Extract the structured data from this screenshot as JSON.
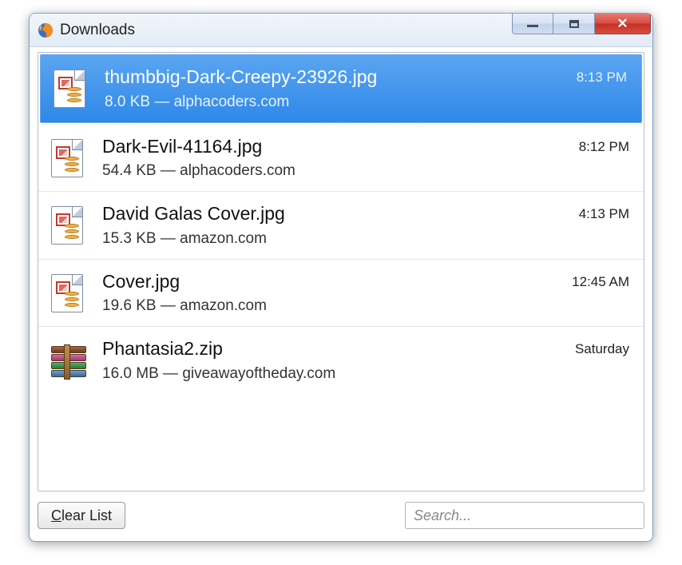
{
  "window": {
    "title": "Downloads"
  },
  "items": [
    {
      "filename": "thumbbig-Dark-Creepy-23926.jpg",
      "size": "8.0 KB",
      "source": "alphacoders.com",
      "time": "8:13 PM",
      "kind": "image",
      "selected": true
    },
    {
      "filename": "Dark-Evil-41164.jpg",
      "size": "54.4 KB",
      "source": "alphacoders.com",
      "time": "8:12 PM",
      "kind": "image",
      "selected": false
    },
    {
      "filename": "David Galas Cover.jpg",
      "size": "15.3 KB",
      "source": "amazon.com",
      "time": "4:13 PM",
      "kind": "image",
      "selected": false
    },
    {
      "filename": "Cover.jpg",
      "size": "19.6 KB",
      "source": "amazon.com",
      "time": "12:45 AM",
      "kind": "image",
      "selected": false
    },
    {
      "filename": "Phantasia2.zip",
      "size": "16.0 MB",
      "source": "giveawayoftheday.com",
      "time": "Saturday",
      "kind": "zip",
      "selected": false
    }
  ],
  "footer": {
    "clear_label": "Clear List",
    "search_placeholder": "Search..."
  }
}
